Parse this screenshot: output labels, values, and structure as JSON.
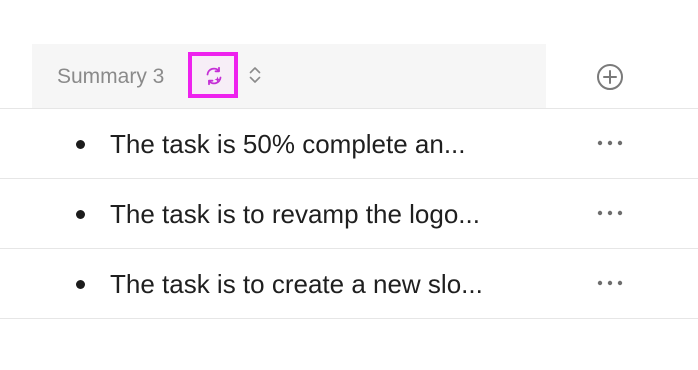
{
  "header": {
    "label": "Summary 3",
    "regenerate_icon": "sparkle-refresh-icon",
    "sort_icon": "chevron-up-down-icon",
    "highlight_color": "#ee22ee",
    "icon_color": "#c52fd6"
  },
  "add_column_icon": "plus-circle-icon",
  "rows": [
    {
      "text": "The task is 50% complete an...",
      "menu_icon": "more-horizontal-icon"
    },
    {
      "text": "The task is to revamp the logo...",
      "menu_icon": "more-horizontal-icon"
    },
    {
      "text": "The task is to create a new slo...",
      "menu_icon": "more-horizontal-icon"
    }
  ]
}
